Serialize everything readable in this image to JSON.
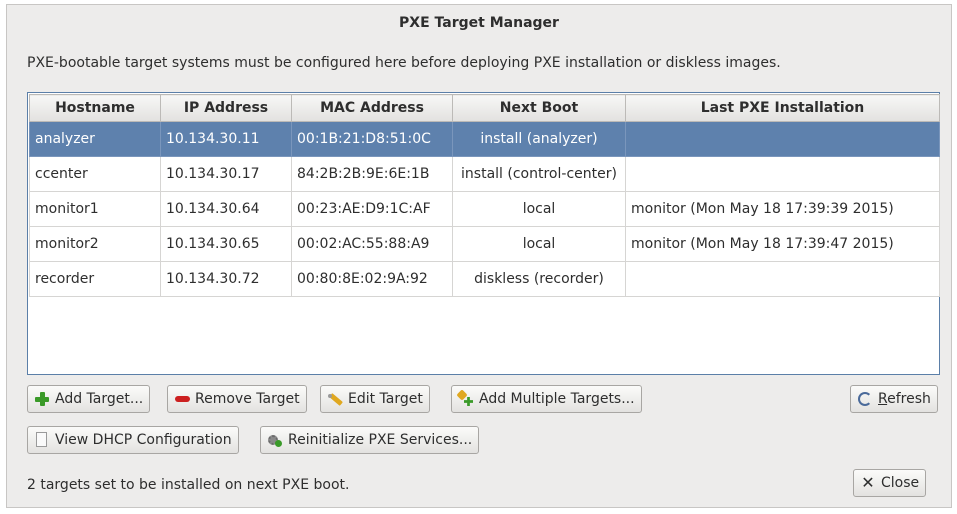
{
  "window": {
    "title": "PXE Target Manager",
    "description": "PXE-bootable target systems must be configured here before deploying PXE installation or diskless images."
  },
  "table": {
    "columns": [
      "Hostname",
      "IP Address",
      "MAC Address",
      "Next Boot",
      "Last PXE Installation"
    ],
    "rows": [
      {
        "hostname": "analyzer",
        "ip": "10.134.30.11",
        "mac": "00:1B:21:D8:51:0C",
        "next_boot": "install (analyzer)",
        "last_install": "",
        "selected": true
      },
      {
        "hostname": "ccenter",
        "ip": "10.134.30.17",
        "mac": "84:2B:2B:9E:6E:1B",
        "next_boot": "install (control-center)",
        "last_install": ""
      },
      {
        "hostname": "monitor1",
        "ip": "10.134.30.64",
        "mac": "00:23:AE:D9:1C:AF",
        "next_boot": "local",
        "last_install": "monitor (Mon May 18 17:39:39 2015)"
      },
      {
        "hostname": "monitor2",
        "ip": "10.134.30.65",
        "mac": "00:02:AC:55:88:A9",
        "next_boot": "local",
        "last_install": "monitor (Mon May 18 17:39:47 2015)"
      },
      {
        "hostname": "recorder",
        "ip": "10.134.30.72",
        "mac": "00:80:8E:02:9A:92",
        "next_boot": "diskless (recorder)",
        "last_install": ""
      }
    ]
  },
  "buttons": {
    "add_target": "Add Target...",
    "remove_target": "Remove Target",
    "edit_target": "Edit Target",
    "add_multiple": "Add Multiple Targets...",
    "refresh_mnemonic": "R",
    "refresh_rest": "efresh",
    "view_dhcp": "View DHCP Configuration",
    "reinit_pxe": "Reinitialize PXE Services...",
    "close": "Close"
  },
  "icons": {
    "add_target": "add-icon",
    "remove_target": "remove-icon",
    "edit_target": "edit-icon",
    "add_multiple": "add-multiple-icon",
    "refresh": "refresh-icon",
    "view_dhcp": "document-icon",
    "reinit_pxe": "services-gear-icon",
    "close": "close-x-icon"
  },
  "status": "2 targets set to be installed on next PXE boot.",
  "colors": {
    "selection": "#5e81ad",
    "window_bg": "#edeceb"
  }
}
